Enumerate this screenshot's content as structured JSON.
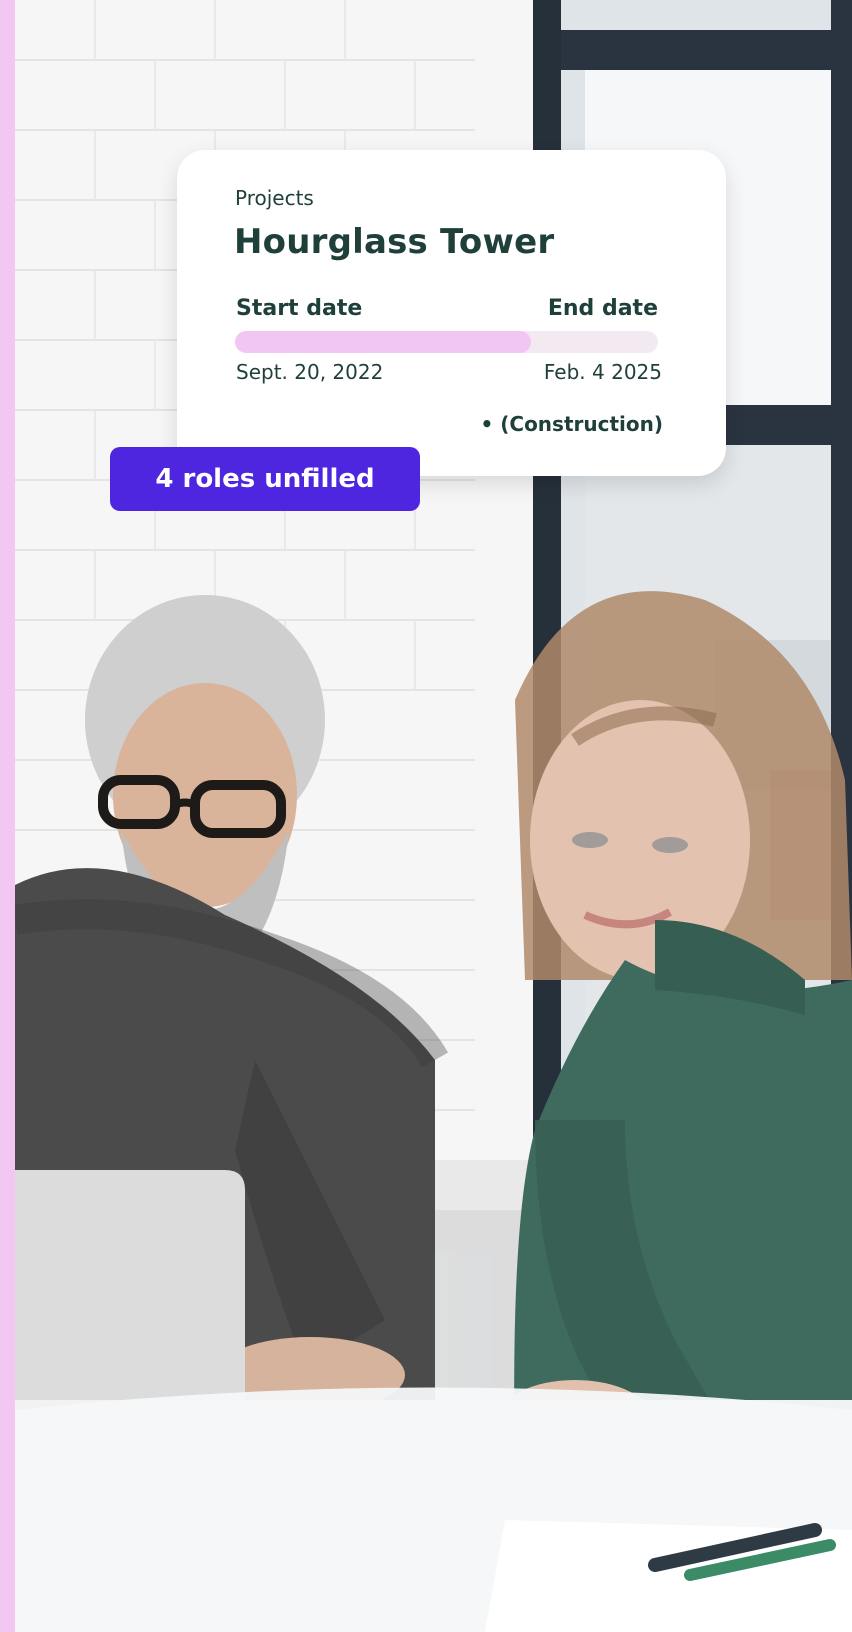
{
  "card": {
    "overline": "Projects",
    "title": "Hourglass Tower",
    "start_label": "Start date",
    "end_label": "End date",
    "start_date": "Sept. 20, 2022",
    "end_date": "Feb. 4 2025",
    "progress_percent": 70,
    "status": "• (Construction)"
  },
  "badge": {
    "label": "4 roles unfilled"
  },
  "colors": {
    "accent": "#4f26df",
    "progress_fill": "#f1c6f3",
    "text_primary": "#1f3f3a",
    "frame": "#f2c8f2"
  }
}
